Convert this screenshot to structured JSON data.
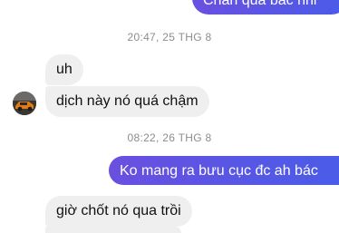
{
  "messages": {
    "top_outgoing": "Chẩn quá bác nhỉ",
    "stamp_1": "20:47, 25 THG 8",
    "in_1": "uh",
    "in_2": "dịch này nó quá chậm",
    "stamp_2": "08:22, 26 THG 8",
    "out_1": "Ko mang ra bưu cục đc ah bác",
    "in_3": "giờ chốt nó qua trồi"
  },
  "colors": {
    "outgoing_bubble": "#5b4fd8",
    "incoming_bubble": "#efefef",
    "timestamp": "#8a8d91"
  },
  "icons": {
    "avatar": "sender-avatar-car"
  }
}
